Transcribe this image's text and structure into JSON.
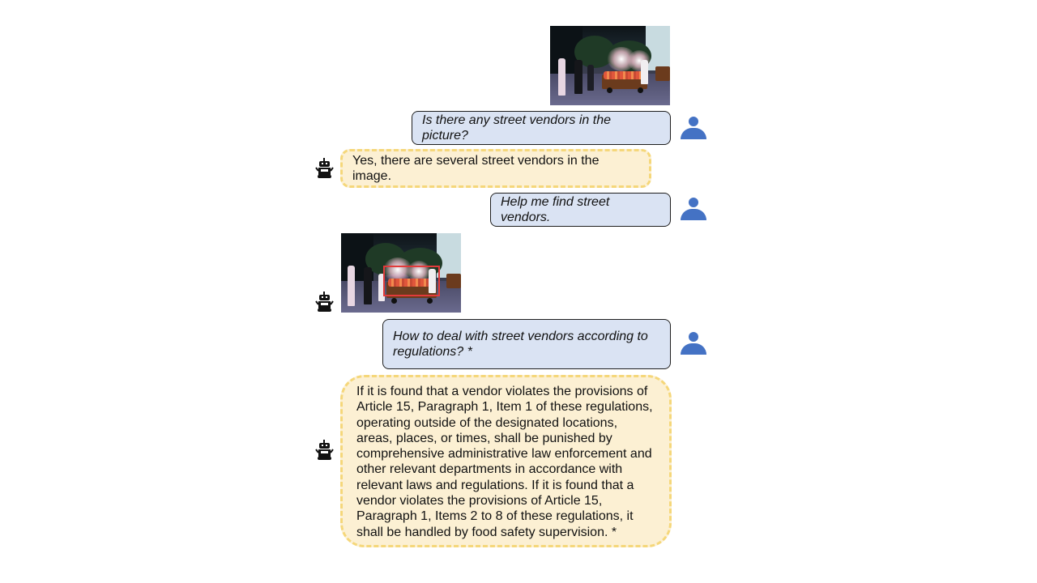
{
  "conversation": {
    "user_question_1": "Is there any street vendors in the picture?",
    "bot_answer_1": "Yes, there are several street vendors in the image.",
    "user_question_2": "Help me find street vendors.",
    "user_question_3": "How to deal with street vendors according to regulations? *",
    "bot_answer_3": "If it is found that a vendor violates the provisions of Article 15, Paragraph 1, Item 1 of these regulations, operating outside of the designated locations, areas, places, or times, shall be punished by comprehensive administrative law enforcement and other relevant departments in accordance with relevant laws and regulations. If it is found that a vendor violates the provisions of Article 15, Paragraph 1, Items 2 to 8 of these regulations, it shall be handled by food safety supervision. *"
  },
  "icons": {
    "user": "user-avatar-icon",
    "bot": "robot-icon"
  },
  "colors": {
    "user_bubble": "#dae3f3",
    "bot_bubble": "#fcf0d3",
    "bot_border": "#f5d77a",
    "user_icon": "#4472c4",
    "bounding_box": "#e23b3b"
  }
}
